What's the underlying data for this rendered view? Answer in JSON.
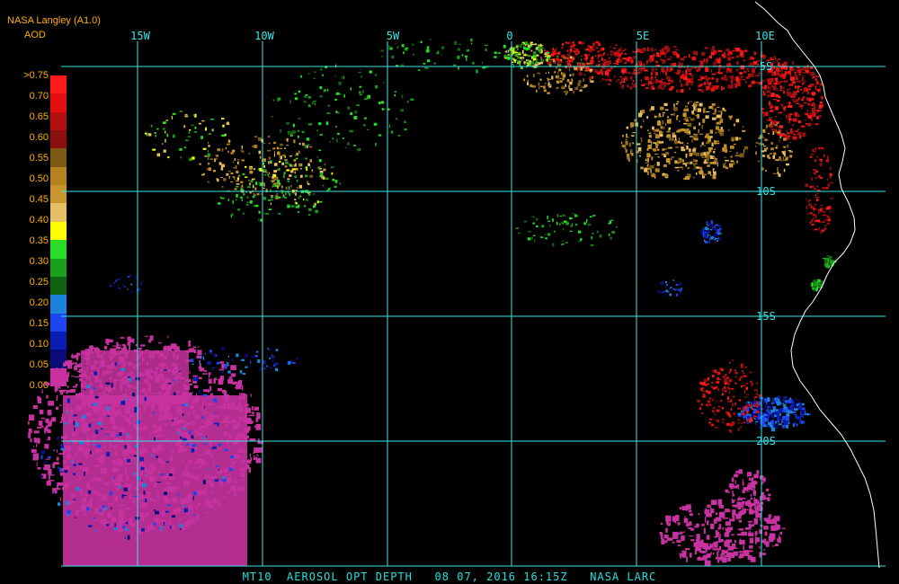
{
  "header": {
    "title": "NASA Langley (A1.0)",
    "product": "AOD"
  },
  "legend": {
    "labels": [
      ">0.75",
      "0.70",
      "0.65",
      "0.60",
      "0.55",
      "0.50",
      "0.45",
      "0.40",
      "0.35",
      "0.30",
      "0.25",
      "0.20",
      "0.15",
      "0.10",
      "0.05",
      "0.00"
    ],
    "colors": [
      "#ff1a1a",
      "#e60f0f",
      "#b40f0f",
      "#8c0f0f",
      "#7c5a14",
      "#b4821e",
      "#c8962d",
      "#e6be64",
      "#ffff00",
      "#28dc28",
      "#1aa01a",
      "#106410",
      "#1e82dc",
      "#1e46f0",
      "#0a1eb4",
      "#0a0a78",
      "#c832a0"
    ]
  },
  "map": {
    "lon_labels": [
      "15W",
      "10W",
      "5W",
      "0",
      "5E",
      "10E"
    ],
    "lat_labels": [
      "5S",
      "10S",
      "15S",
      "20S"
    ],
    "grid_color": "#3ce6e6",
    "coast_color": "#ffffff"
  },
  "footer": {
    "text": "MT10  AEROSOL OPT DEPTH   08 07, 2016 16:15Z   NASA LARC"
  }
}
